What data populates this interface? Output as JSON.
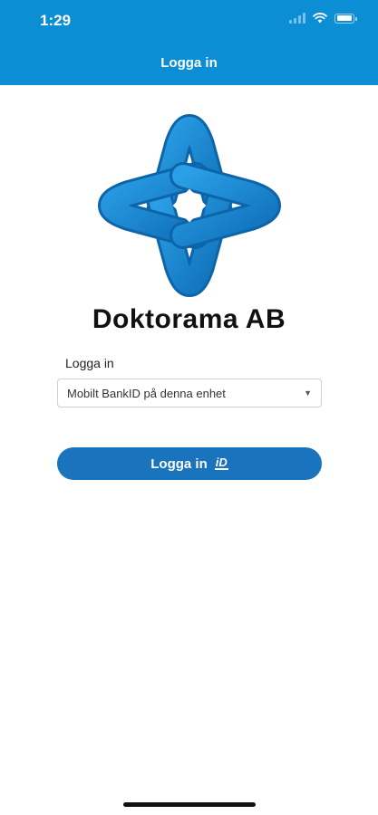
{
  "status_bar": {
    "time": "1:29",
    "icons": [
      "signal-icon",
      "wifi-icon",
      "battery-icon"
    ]
  },
  "nav": {
    "title": "Logga in"
  },
  "brand": {
    "company_name": "Doktorama AB",
    "logo": "knot-cross-logo"
  },
  "form": {
    "label": "Logga in",
    "method_selected": "Mobilt BankID på denna enhet"
  },
  "login_button": {
    "label": "Logga in",
    "icon": "bankid-icon"
  },
  "colors": {
    "header": "#0b8ed4",
    "button": "#1a73bd",
    "logo_blue": "#1e8fd6"
  }
}
